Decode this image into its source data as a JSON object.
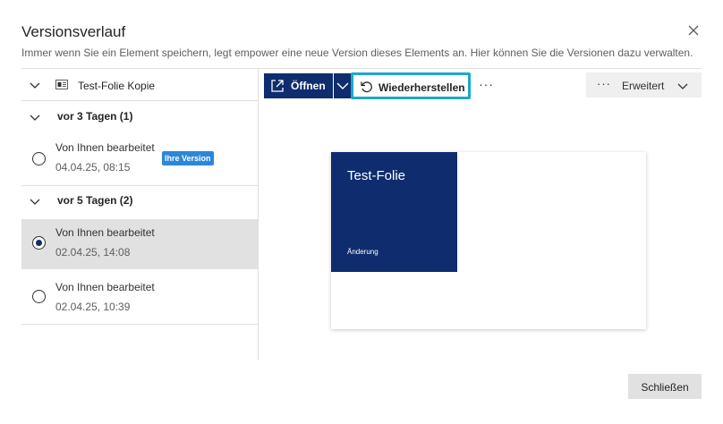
{
  "dialog": {
    "title": "Versionsverlauf",
    "subtitle": "Immer wenn Sie ein Element speichern, legt empower eine neue Version dieses Elements an. Hier können Sie die Versionen dazu verwalten."
  },
  "file": {
    "name": "Test-Folie Kopie"
  },
  "groups": [
    {
      "label": "vor 3 Tagen (1)",
      "items": [
        {
          "edited": "Von Ihnen bearbeitet",
          "date": "04.04.25, 08:15",
          "badge": "Ihre Version",
          "selected": false
        }
      ]
    },
    {
      "label": "vor 5 Tagen (2)",
      "items": [
        {
          "edited": "Von Ihnen bearbeitet",
          "date": "02.04.25, 14:08",
          "selected": true
        },
        {
          "edited": "Von Ihnen bearbeitet",
          "date": "02.04.25, 10:39",
          "selected": false
        }
      ]
    }
  ],
  "toolbar": {
    "open_label": "Öffnen",
    "restore_label": "Wiederherstellen",
    "more_label": "···",
    "advanced_label": "Erweitert",
    "advanced_dots": "···"
  },
  "preview": {
    "slide_title": "Test-Folie",
    "slide_subtitle": "Änderung"
  },
  "footer": {
    "close_label": "Schließen"
  },
  "colors": {
    "accent": "#0f2c6e",
    "highlight": "#1ba9c8",
    "badge": "#2b88d8"
  }
}
